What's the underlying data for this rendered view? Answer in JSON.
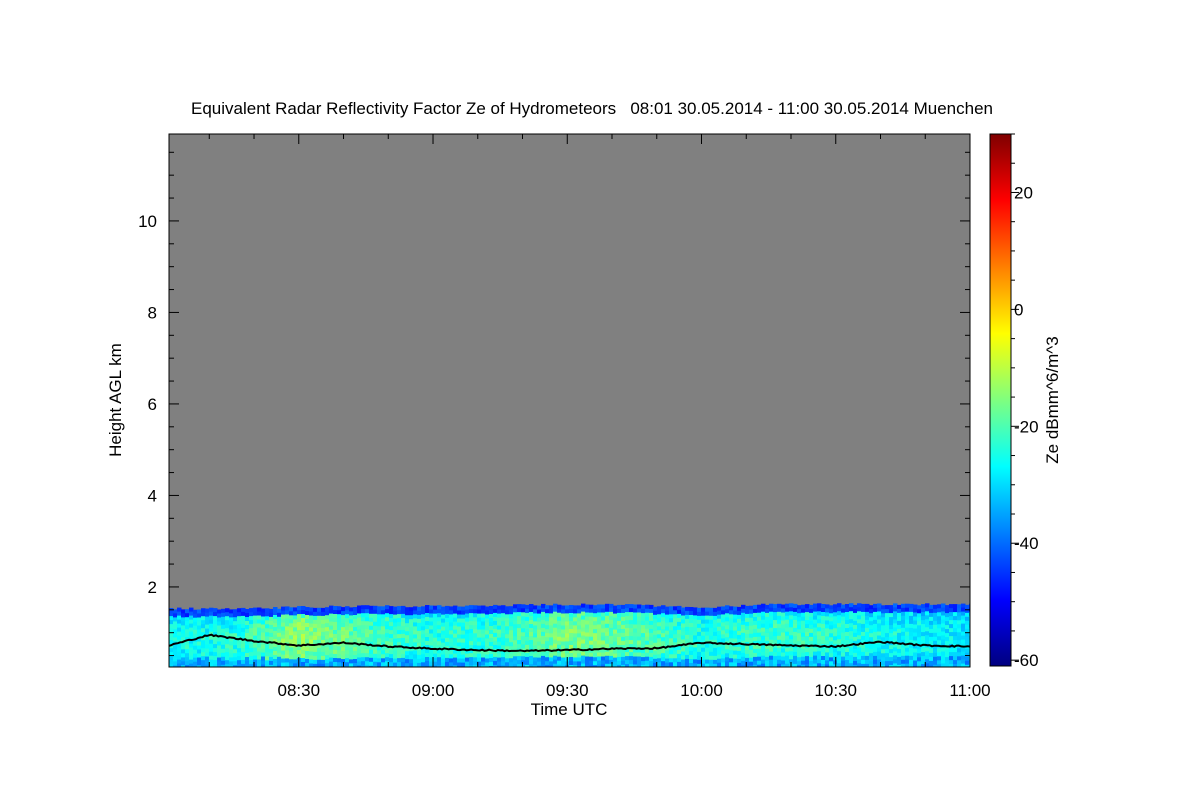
{
  "chart_data": {
    "type": "heatmap",
    "title": "Equivalent Radar Reflectivity Factor Ze of Hydrometeors   08:01 30.05.2014 - 11:00 30.05.2014 Muenchen",
    "xlabel": "Time UTC",
    "ylabel": "Height AGL km",
    "colorbar_label": "Ze dBmm^6/m^3",
    "x_ticks": [
      "08:30",
      "09:00",
      "09:30",
      "10:00",
      "10:30",
      "11:00"
    ],
    "x_tick_minutes": [
      30,
      60,
      90,
      120,
      150,
      180
    ],
    "x_range_minutes": [
      1,
      180
    ],
    "y_ticks": [
      2,
      4,
      6,
      8,
      10
    ],
    "y_range_km": [
      0.25,
      11.9
    ],
    "colorbar_ticks": [
      20,
      0,
      -20,
      -40,
      -60
    ],
    "colorbar_range": [
      -61,
      30
    ],
    "background_color": "#808080",
    "colormap": [
      "#00007f",
      "#0000ff",
      "#007fff",
      "#00ffff",
      "#7fff7f",
      "#ffff00",
      "#ff7f00",
      "#ff0000",
      "#7f0000"
    ],
    "echo_layer": {
      "description_values_km": {
        "top_min": 1.45,
        "top_max": 1.62,
        "bottom": 0.25
      },
      "time_minutes": [
        1,
        15,
        30,
        45,
        60,
        75,
        90,
        105,
        120,
        135,
        150,
        165,
        180
      ],
      "top_km": [
        1.53,
        1.52,
        1.56,
        1.58,
        1.58,
        1.6,
        1.62,
        1.6,
        1.55,
        1.62,
        1.62,
        1.62,
        1.62
      ],
      "typical_ze_dbz": [
        -32,
        -30,
        -20,
        -26,
        -30,
        -28,
        -22,
        -25,
        -30,
        -28,
        -30,
        -32,
        -34
      ]
    },
    "cloud_base_line": {
      "time_minutes": [
        1,
        10,
        20,
        30,
        40,
        50,
        60,
        70,
        80,
        90,
        100,
        110,
        120,
        130,
        140,
        150,
        160,
        170,
        180
      ],
      "height_km": [
        0.72,
        0.95,
        0.82,
        0.72,
        0.78,
        0.7,
        0.65,
        0.62,
        0.6,
        0.62,
        0.65,
        0.66,
        0.78,
        0.75,
        0.72,
        0.7,
        0.8,
        0.72,
        0.7
      ]
    },
    "grid": false,
    "legend": "colorbar-right"
  }
}
